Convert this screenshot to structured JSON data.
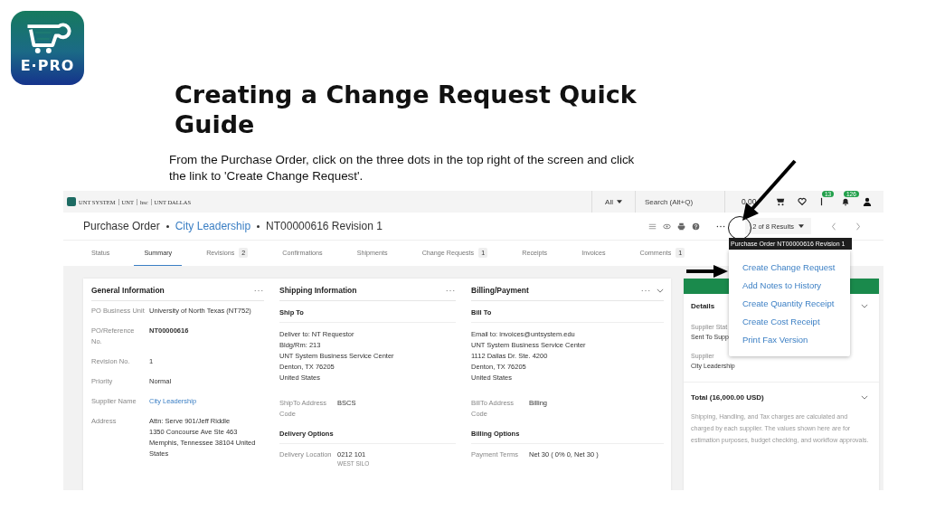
{
  "logo": {
    "text": "E·PRO"
  },
  "title": "Creating a Change Request Quick Guide",
  "instructions": "From the Purchase Order, click on the three dots in the top right of the screen and click the link to 'Create Change Request'.",
  "app": {
    "brand_logos": [
      "UNT SYSTEM",
      "UNT",
      "hsc",
      "UNT DALLAS"
    ],
    "top_bar": {
      "scope": "All",
      "search_placeholder": "Search (Alt+Q)",
      "cart_total": "0.00",
      "flag_badge": "13",
      "bell_badge": "126"
    },
    "breadcrumb": [
      {
        "label": "Purchase Order",
        "link": false
      },
      {
        "label": "City Leadership",
        "link": true
      },
      {
        "label": "NT00000616 Revision 1",
        "link": false
      }
    ],
    "results": "2 of 8 Results",
    "tabs": [
      {
        "label": "Status",
        "selected": false
      },
      {
        "label": "Summary",
        "selected": true
      },
      {
        "label": "Revisions",
        "count": "2",
        "selected": false
      },
      {
        "label": "Confirmations",
        "selected": false
      },
      {
        "label": "Shipments",
        "selected": false
      },
      {
        "label": "Change Requests",
        "count": "1",
        "selected": false
      },
      {
        "label": "Receipts",
        "selected": false
      },
      {
        "label": "Invoices",
        "selected": false
      },
      {
        "label": "Comments",
        "count": "1",
        "selected": false
      }
    ],
    "cards": [
      {
        "title": "General Information",
        "collapsible": false,
        "sections": [
          {
            "fields": [
              {
                "label": "PO Business Unit",
                "lines": [
                  "University of North Texas (NT752)"
                ],
                "kind": "text"
              },
              {
                "label": "PO/Reference No.",
                "lines": [
                  "NT00000616"
                ],
                "kind": "bold"
              },
              {
                "label": "Revision No.",
                "lines": [
                  "1"
                ],
                "kind": "text"
              },
              {
                "label": "Priority",
                "lines": [
                  "Normal"
                ],
                "kind": "text"
              },
              {
                "label": "Supplier Name",
                "lines": [
                  "City Leadership"
                ],
                "kind": "link"
              },
              {
                "label": "Address",
                "lines": [
                  "Attn: Serve 901/Jeff Riddle",
                  "1350 Concourse Ave Ste 463",
                  "Memphis, Tennessee 38104 United States"
                ],
                "kind": "text"
              }
            ]
          }
        ]
      },
      {
        "title": "Shipping Information",
        "collapsible": false,
        "sections": [
          {
            "heading": "Ship To",
            "address": [
              "Deliver to: NT Requestor",
              "Bldg/Rm: 213",
              "UNT System Business Service Center",
              "Denton, TX 76205",
              "United States"
            ],
            "fields": [
              {
                "label": "ShipTo Address Code",
                "lines": [
                  "BSCS"
                ],
                "kind": "text"
              }
            ]
          },
          {
            "heading": "Delivery Options",
            "fields": [
              {
                "label": "Delivery Location",
                "lines": [
                  "0212 101"
                ],
                "note": "WEST SILO",
                "kind": "text"
              }
            ]
          }
        ]
      },
      {
        "title": "Billing/Payment",
        "collapsible": true,
        "sections": [
          {
            "heading": "Bill To",
            "address": [
              "Email to: invoices@untsystem.edu",
              "UNT System Business Service Center",
              "1112 Dallas Dr. Ste. 4200",
              "Denton, TX 76205",
              "United States"
            ],
            "fields": [
              {
                "label": "BillTo Address Code",
                "lines": [
                  "Billing"
                ],
                "kind": "text"
              }
            ]
          },
          {
            "heading": "Billing Options",
            "fields": [
              {
                "label": "Payment Terms",
                "lines": [
                  "Net 30 ( 0% 0, Net 30 )"
                ],
                "kind": "text"
              }
            ]
          }
        ]
      }
    ],
    "side_panel": {
      "details": {
        "title": "Details",
        "rows": [
          {
            "label": "Supplier Stat",
            "value": "Sent To Supp"
          },
          {
            "label": "Supplier",
            "value": "City Leadership"
          }
        ]
      },
      "total": {
        "title": "Total (16,000.00 USD)",
        "note": "Shipping, Handling, and Tax charges are calculated and charged by each supplier. The values shown here are for estimation purposes, budget checking, and workflow approvals."
      }
    },
    "tooltip": "Purchase Order NT00000616 Revision 1",
    "menu": [
      "Create Change Request",
      "Add Notes to History",
      "Create Quantity Receipt",
      "Create Cost Receipt",
      "Print Fax Version"
    ]
  }
}
